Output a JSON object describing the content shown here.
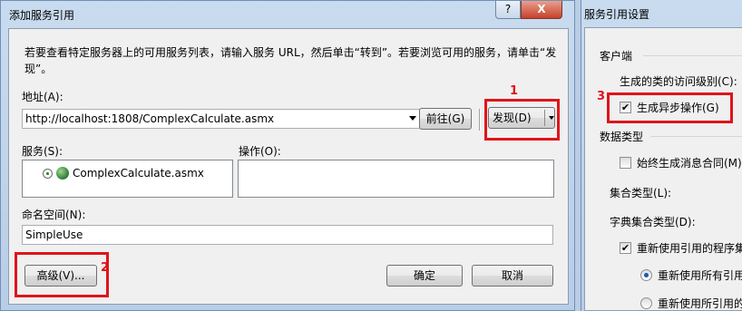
{
  "dialog": {
    "title": "添加服务引用",
    "help_label": "?",
    "close_label": "X",
    "intro": "若要查看特定服务器上的可用服务列表，请输入服务 URL，然后单击“转到”。若要浏览可用的服务，请单击“发现”。",
    "address_label": "地址(A):",
    "address_value": "http://localhost:1808/ComplexCalculate.asmx",
    "go_button": "前往(G)",
    "discover_button": "发现(D)",
    "services_label": "服务(S):",
    "operations_label": "操作(O):",
    "services": [
      "ComplexCalculate.asmx"
    ],
    "namespace_label": "命名空间(N):",
    "namespace_value": "SimpleUse",
    "advanced_button": "高级(V)...",
    "ok_button": "确定",
    "cancel_button": "取消"
  },
  "annotations": {
    "one": "1",
    "two": "2",
    "three": "3",
    "color": "#e0141a"
  },
  "settings": {
    "title": "服务引用设置",
    "client_header": "客户端",
    "access_level_label": "生成的类的访问级别(C):",
    "async_label": "生成异步操作(G)",
    "async_checked": true,
    "data_type_header": "数据类型",
    "always_generate_label": "始终生成消息合同(M)",
    "always_generate_checked": false,
    "collection_type_label": "集合类型(L):",
    "dict_collection_type_label": "字典集合类型(D):",
    "reuse_types_label": "重新使用引用的程序集",
    "reuse_types_checked": true,
    "reuse_all_label": "重新使用所有引用",
    "reuse_all_selected": true,
    "reuse_specified_label": "重新使用所引用的"
  }
}
